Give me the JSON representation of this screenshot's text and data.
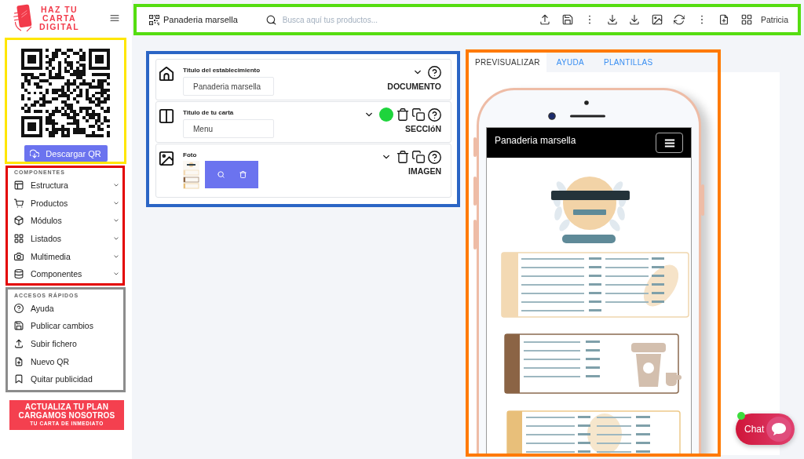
{
  "brand": {
    "logo_lines": [
      "HAZ TU",
      "CARTA",
      "DIGITAL"
    ]
  },
  "qr_panel": {
    "button": "Descargar QR"
  },
  "components": {
    "heading": "COMPONENTES",
    "items": [
      "Estructura",
      "Productos",
      "Módulos",
      "Listados",
      "Multimedia",
      "Componentes"
    ]
  },
  "quick_access": {
    "heading": "ACCESOS RÁPIDOS",
    "items": [
      "Ayuda",
      "Publicar cambios",
      "Subir fichero",
      "Nuevo QR",
      "Quitar publicidad"
    ]
  },
  "promo": {
    "lines": [
      "ACTUALIZA TU PLAN",
      "CARGAMOS NOSOTROS",
      "TU CARTA DE INMEDIATO"
    ]
  },
  "toolbar": {
    "project": "Panaderia marsella",
    "search": {
      "placeholder": "Busca aquí tus productos..."
    },
    "user": "Patricia"
  },
  "editor": {
    "blocks": [
      {
        "kind": "document",
        "label": "Titulo del establecimiento",
        "value": "Panaderia marsella",
        "type_label": "DOCUMENTO"
      },
      {
        "kind": "section",
        "label": "Titulo de tu carta",
        "value": "Menu",
        "type_label": "SECCIóN",
        "color": "#1ed43c"
      },
      {
        "kind": "image",
        "label": "Foto",
        "type_label": "IMAGEN"
      }
    ]
  },
  "preview": {
    "tabs": [
      {
        "label": "PREVISUALIZAR",
        "selected": true
      },
      {
        "label": "AYUDA",
        "selected": false
      },
      {
        "label": "PLANTILLAS",
        "selected": false
      }
    ],
    "site_title": "Panaderia marsella"
  },
  "chat": {
    "label": "Chat",
    "online": true
  }
}
